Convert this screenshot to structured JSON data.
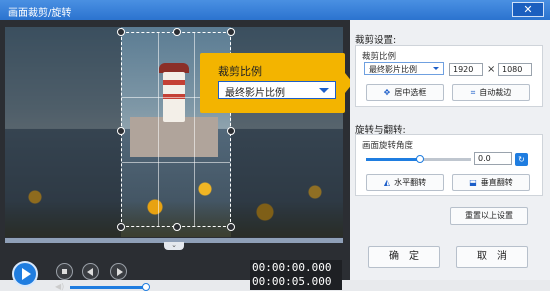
{
  "window": {
    "title": "画面裁剪/旋转",
    "close_glyph": "✕"
  },
  "crop_popup": {
    "label": "裁剪比例",
    "value": "最终影片比例"
  },
  "player": {
    "time_current": "00:00:00.000",
    "time_total": "00:00:05.000",
    "volume_percent": 100
  },
  "crop_settings": {
    "title": "裁剪设置:",
    "ratio_label": "裁剪比例",
    "ratio_value": "最终影片比例",
    "width": "1920",
    "times_glyph": "×",
    "height": "1080",
    "center_button": "居中选框",
    "auto_edge_button": "自动裁边"
  },
  "rotate_flip": {
    "title": "旋转与翻转:",
    "angle_label": "画面旋转角度",
    "angle_value": "0.0",
    "angle_slider_percent": 50,
    "flip_h_button": "水平翻转",
    "flip_v_button": "垂直翻转"
  },
  "reset_button": "重置以上设置",
  "ok_button": "确　定",
  "cancel_button": "取　消",
  "colors": {
    "accent": "#1f7de0",
    "popup": "#f3b400",
    "titlebar": "#2b73cf"
  }
}
